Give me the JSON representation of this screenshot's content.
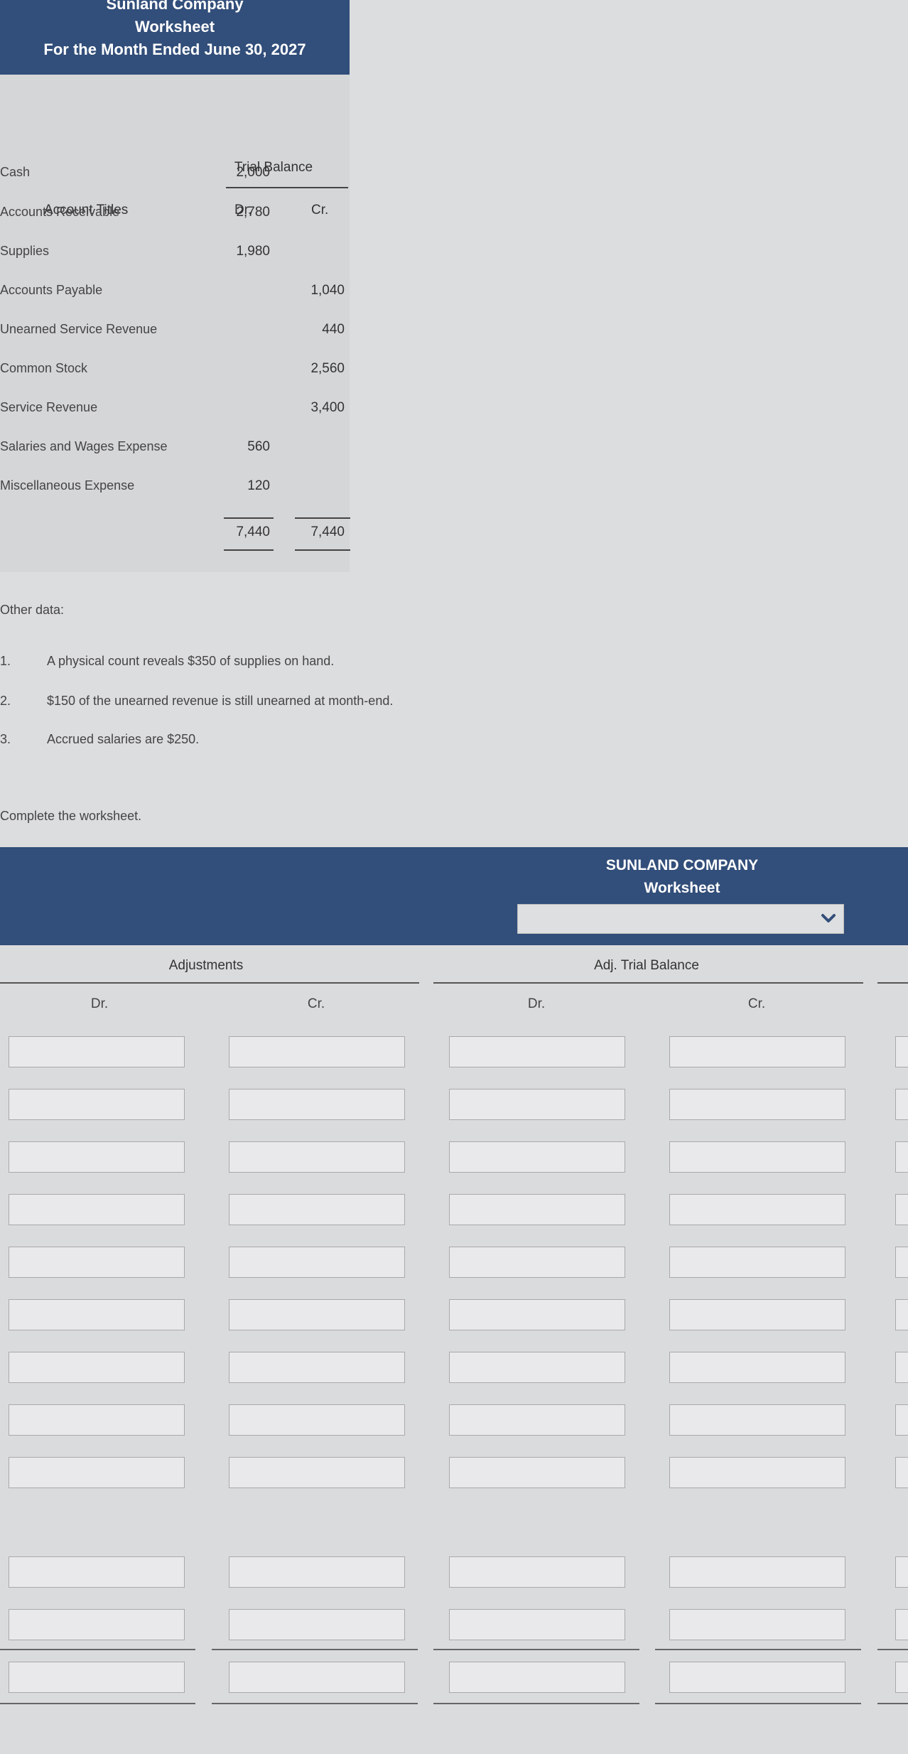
{
  "header": {
    "company": "Sunland Company",
    "title": "Worksheet",
    "period": "For the Month Ended June 30, 2027"
  },
  "trial_balance": {
    "heading": "Trial Balance",
    "col_account": "Account Titles",
    "col_dr": "Dr.",
    "col_cr": "Cr.",
    "rows": [
      {
        "account": "Cash",
        "dr": "2,000",
        "cr": ""
      },
      {
        "account": "Accounts Receivable",
        "dr": "2,780",
        "cr": ""
      },
      {
        "account": "Supplies",
        "dr": "1,980",
        "cr": ""
      },
      {
        "account": "Accounts Payable",
        "dr": "",
        "cr": "1,040"
      },
      {
        "account": "Unearned Service Revenue",
        "dr": "",
        "cr": "440"
      },
      {
        "account": "Common Stock",
        "dr": "",
        "cr": "2,560"
      },
      {
        "account": "Service Revenue",
        "dr": "",
        "cr": "3,400"
      },
      {
        "account": "Salaries and Wages Expense",
        "dr": "560",
        "cr": ""
      },
      {
        "account": "Miscellaneous Expense",
        "dr": "120",
        "cr": ""
      }
    ],
    "total_dr": "7,440",
    "total_cr": "7,440"
  },
  "other_data": {
    "label": "Other data:",
    "items": [
      {
        "num": "1.",
        "text": "A physical count reveals $350 of supplies on hand."
      },
      {
        "num": "2.",
        "text": "$150 of the unearned revenue is still unearned at month-end."
      },
      {
        "num": "3.",
        "text": "Accrued salaries are $250."
      }
    ]
  },
  "instruction": "Complete the worksheet.",
  "worksheet": {
    "company": "SUNLAND COMPANY",
    "title": "Worksheet",
    "period_select": "",
    "adjustments_heading": "Adjustments",
    "adj_tb_heading": "Adj. Trial Balance",
    "dr": "Dr.",
    "cr": "Cr."
  }
}
